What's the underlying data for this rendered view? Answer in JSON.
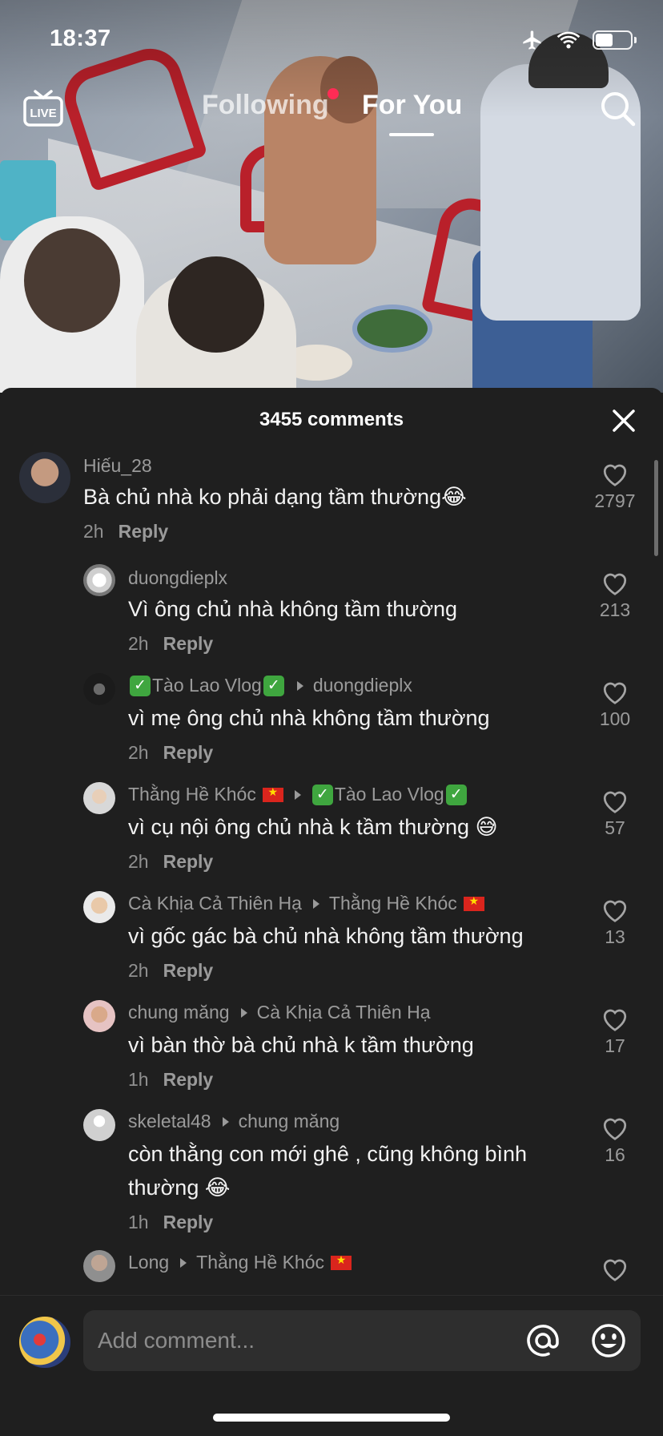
{
  "status_bar": {
    "time": "18:37",
    "battery_level": 0.45
  },
  "top_nav": {
    "live_label": "LIVE",
    "following_label": "Following",
    "foryou_label": "For You"
  },
  "sheet": {
    "title": "3455 comments"
  },
  "comments": [
    {
      "name": "Hiếu_28",
      "reply_to": "",
      "text": "Bà chủ nhà ko phải dạng tầm thường😂",
      "time": "2h",
      "reply_label": "Reply",
      "likes": "2797"
    },
    {
      "name": "duongdieplx",
      "reply_to": "",
      "text": "Vì ông chủ nhà không tầm thường",
      "time": "2h",
      "reply_label": "Reply",
      "likes": "213"
    },
    {
      "name": "Tào Lao Vlog",
      "reply_to": "duongdieplx",
      "text": "vì mẹ ông chủ nhà không tầm thường",
      "time": "2h",
      "reply_label": "Reply",
      "likes": "100"
    },
    {
      "name": "Thằng Hề Khóc",
      "reply_to": "Tào Lao Vlog",
      "text": "vì cụ nội ông chủ nhà k tầm thường 😅",
      "time": "2h",
      "reply_label": "Reply",
      "likes": "57"
    },
    {
      "name": "Cà Khịa Cả Thiên Hạ",
      "reply_to": "Thằng Hề Khóc",
      "text": "vì gốc gác bà chủ nhà không tầm thường",
      "time": "2h",
      "reply_label": "Reply",
      "likes": "13"
    },
    {
      "name": "chung măng",
      "reply_to": "Cà Khịa Cả Thiên Hạ",
      "text": "vì bàn thờ bà chủ nhà k tầm thường",
      "time": "1h",
      "reply_label": "Reply",
      "likes": "17"
    },
    {
      "name": "skeletal48",
      "reply_to": "chung măng",
      "text": "còn thằng con mới ghê , cũng không bình thường 😂",
      "time": "1h",
      "reply_label": "Reply",
      "likes": "16"
    },
    {
      "name": "Long",
      "reply_to": "Thằng Hề Khóc",
      "text": "",
      "time": "",
      "reply_label": "",
      "likes": ""
    }
  ],
  "compose": {
    "placeholder": "Add comment..."
  },
  "colors": {
    "background": "#1f1f1f",
    "input_bg": "#2e2e2e",
    "accent_dot": "#fe2c55"
  },
  "icons": [
    "live-icon",
    "search-icon",
    "close-icon",
    "heart-icon",
    "mention-icon",
    "emoji-icon",
    "airplane-icon",
    "wifi-icon",
    "battery-icon"
  ]
}
